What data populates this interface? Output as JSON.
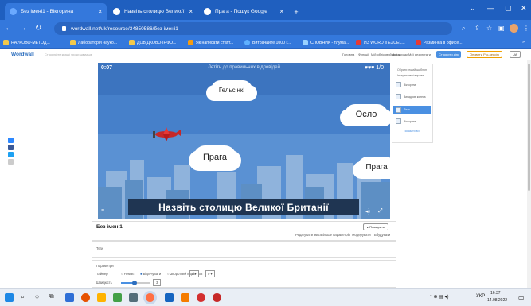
{
  "browser": {
    "tabs": [
      {
        "label": "Без імені1 - Вікторина",
        "active": true
      },
      {
        "label": "Назвіть столицю Великої Брита...",
        "active": false
      },
      {
        "label": "Прага - Пошук Google",
        "active": false
      }
    ],
    "new_tab": "+",
    "url": "wordwall.net/uk/resource/34850586/без-імені1",
    "bookmarks": [
      "НАУКОВО-МЕТОД...",
      "Лабораторія науко...",
      "ДОВІДКОВО-ІНФО...",
      "Як написати статт...",
      "Витрачайте 1000 г...",
      "СЛОВНИК - тлума...",
      "ИЗ WORD в EXCEL...",
      "Разминка в офисе..."
    ],
    "bookmarks_more": "»"
  },
  "wordwall": {
    "logo": "Wordwall",
    "tagline": "Створюйте кращі уроки швидше",
    "nav": [
      "Головна",
      "Функції",
      "Мій обліковий запис",
      "Мої заходи",
      "Мої результати"
    ],
    "create_button": "Створити дію",
    "upgrade_button": "Оновити Pro-версію",
    "lang_button": "UA"
  },
  "game": {
    "timer": "0:07",
    "instruction": "Летіть до правильних відповідей",
    "lives": "♥♥♥ 1/0",
    "answers": [
      "Гельсінкі",
      "Осло",
      "Прага",
      "Прага"
    ],
    "question": "Назвіть столицю Великої Британії"
  },
  "right_panel": {
    "title": "Обрати інший шаблон",
    "subtitle": "Інтерактивні вправи",
    "options": [
      "Вікторина",
      "Випадкові колеса",
      "Літак",
      "Вікторина"
    ],
    "more": "Показати всі"
  },
  "activity": {
    "title": "Без імені1",
    "share_button": "▸ Поширити",
    "actions": [
      "Редагувати зміст",
      "Більше параметрів",
      "Модерувати",
      "Вбудувати"
    ],
    "tags_label": "Теги",
    "params_label": "Параметри",
    "timer_label": "Таймер",
    "timer_options": [
      "Немає",
      "Відлічувати",
      "Зворотний відлік"
    ],
    "timer_min": "5 ▾",
    "timer_sep": "хв",
    "timer_sec": "0 ▾",
    "speed_label": "Швидкість",
    "speed_value": "3"
  },
  "taskbar": {
    "lang": "УКР",
    "time": "16:37",
    "date": "14.08.2022"
  },
  "colors": {
    "chrome_dark": "#1f5fbf",
    "chrome": "#3478dc",
    "sky": "#4a84cc",
    "question_bg": "#1f3552"
  }
}
